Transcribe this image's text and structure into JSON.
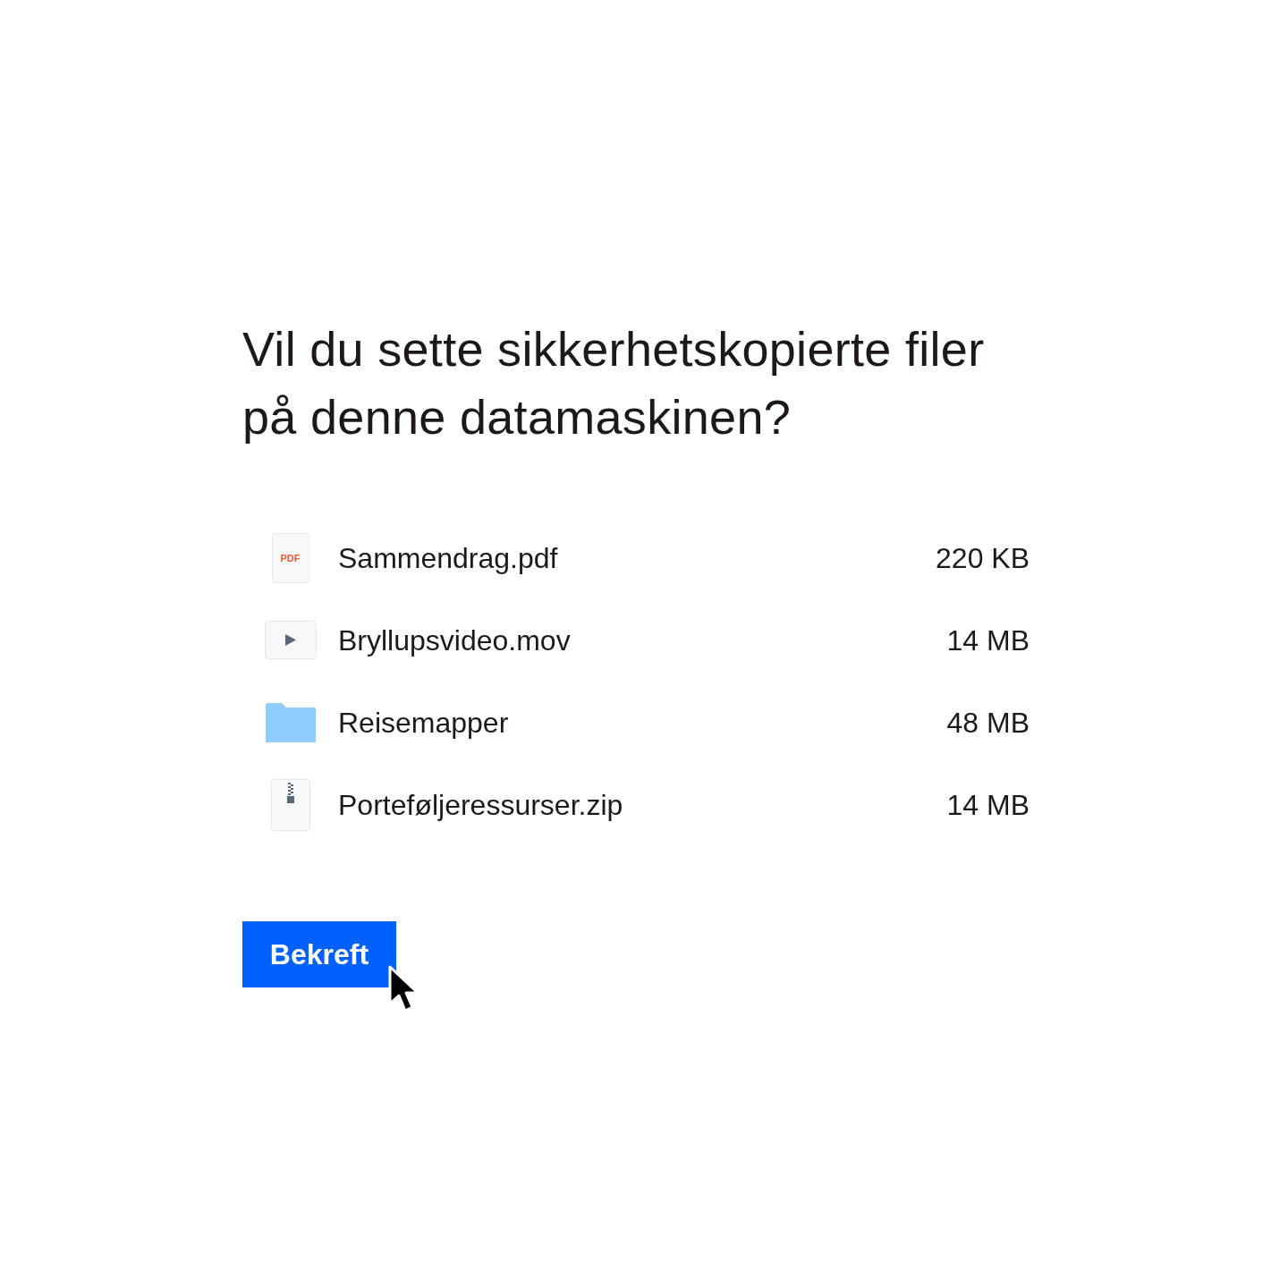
{
  "title": "Vil du sette sikkerhetskopierte filer på denne datamaskinen?",
  "files": [
    {
      "kind": "pdf",
      "badge": "PDF",
      "name": "Sammendrag.pdf",
      "size": "220 KB"
    },
    {
      "kind": "video",
      "name": "Bryllupsvideo.mov",
      "size": "14 MB"
    },
    {
      "kind": "folder",
      "name": "Reisemapper",
      "size": "48 MB"
    },
    {
      "kind": "zip",
      "name": "Porteføljeressurser.zip",
      "size": "14 MB"
    }
  ],
  "button": {
    "label": "Bekreft"
  }
}
